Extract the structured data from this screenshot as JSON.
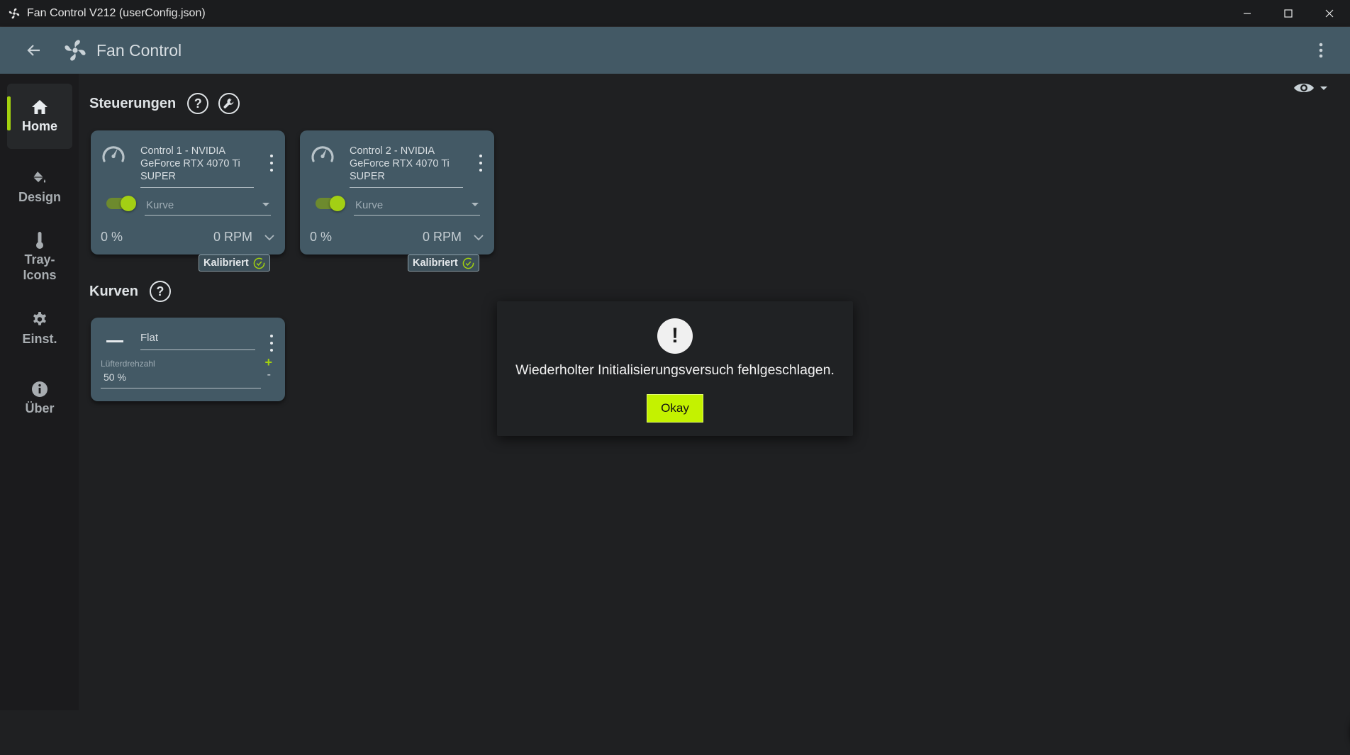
{
  "window": {
    "title": "Fan Control V212 (userConfig.json)"
  },
  "appbar": {
    "title": "Fan Control"
  },
  "sidebar": {
    "items": [
      {
        "label": "Home",
        "icon": "home-icon",
        "active": true
      },
      {
        "label": "Design",
        "icon": "paint-bucket-icon"
      },
      {
        "label": "Tray-\nIcons",
        "icon": "thermometer-icon"
      },
      {
        "label": "Einst.",
        "icon": "gear-icon"
      },
      {
        "label": "Über",
        "icon": "info-icon"
      }
    ]
  },
  "controls": {
    "title": "Steuerungen",
    "cards": [
      {
        "name": "Control 1 - NVIDIA GeForce RTX 4070 Ti SUPER",
        "enabled": true,
        "curve_placeholder": "Kurve",
        "percent": "0 %",
        "rpm": "0 RPM",
        "badge": "Kalibriert"
      },
      {
        "name": "Control 2 - NVIDIA GeForce RTX 4070 Ti SUPER",
        "enabled": true,
        "curve_placeholder": "Kurve",
        "percent": "0 %",
        "rpm": "0 RPM",
        "badge": "Kalibriert"
      }
    ]
  },
  "curves": {
    "title": "Kurven",
    "cards": [
      {
        "name": "Flat",
        "label": "Lüfterdrehzahl",
        "value": "50 %",
        "plus": "+",
        "minus": "-"
      }
    ]
  },
  "dialog": {
    "message": "Wiederholter Initialisierungsversuch fehlgeschlagen.",
    "button": "Okay",
    "icon": "!"
  },
  "colors": {
    "accent": "#a3d10f",
    "appbar": "#435965",
    "card": "#435965",
    "background": "#1f2022",
    "ok_button": "#c4f200"
  }
}
